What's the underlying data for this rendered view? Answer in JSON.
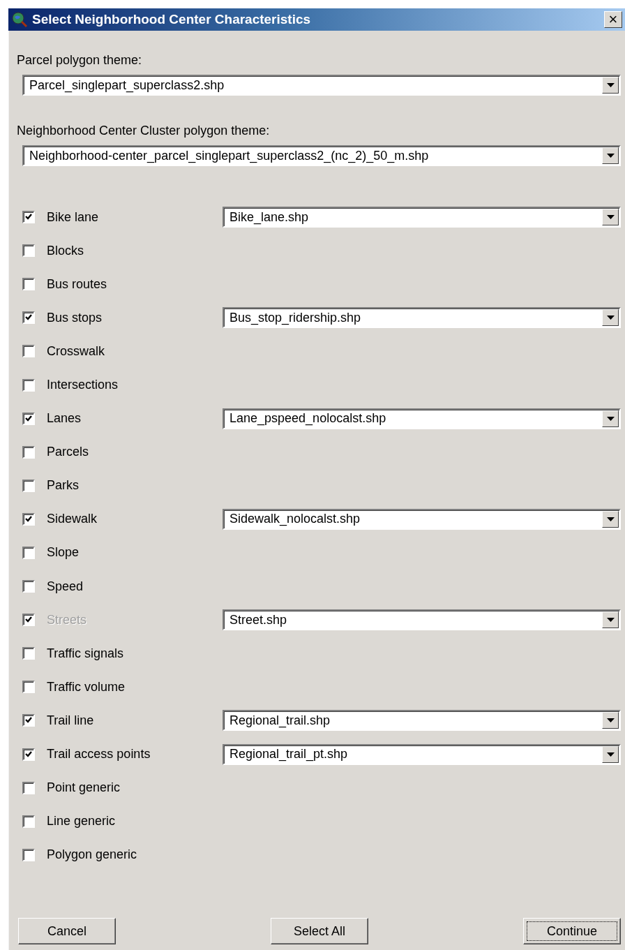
{
  "window": {
    "title": "Select Neighborhood Center Characteristics",
    "close": "×"
  },
  "themes": [
    {
      "label": "Parcel polygon theme:",
      "value": "Parcel_singlepart_superclass2.shp"
    },
    {
      "label": "Neighborhood Center Cluster polygon theme:",
      "value": "Neighborhood-center_parcel_singlepart_superclass2_(nc_2)_50_m.shp"
    }
  ],
  "layers": [
    {
      "label": "Bike lane",
      "checked": true,
      "disabled": false,
      "file": "Bike_lane.shp"
    },
    {
      "label": "Blocks",
      "checked": false,
      "disabled": false
    },
    {
      "label": "Bus routes",
      "checked": false,
      "disabled": false
    },
    {
      "label": "Bus stops",
      "checked": true,
      "disabled": false,
      "file": "Bus_stop_ridership.shp"
    },
    {
      "label": "Crosswalk",
      "checked": false,
      "disabled": false
    },
    {
      "label": "Intersections",
      "checked": false,
      "disabled": false
    },
    {
      "label": "Lanes",
      "checked": true,
      "disabled": false,
      "file": "Lane_pspeed_nolocalst.shp"
    },
    {
      "label": "Parcels",
      "checked": false,
      "disabled": false
    },
    {
      "label": "Parks",
      "checked": false,
      "disabled": false
    },
    {
      "label": "Sidewalk",
      "checked": true,
      "disabled": false,
      "file": "Sidewalk_nolocalst.shp"
    },
    {
      "label": "Slope",
      "checked": false,
      "disabled": false
    },
    {
      "label": "Speed",
      "checked": false,
      "disabled": false
    },
    {
      "label": "Streets",
      "checked": true,
      "disabled": true,
      "file": "Street.shp"
    },
    {
      "label": "Traffic signals",
      "checked": false,
      "disabled": false
    },
    {
      "label": "Traffic volume",
      "checked": false,
      "disabled": false
    },
    {
      "label": "Trail line",
      "checked": true,
      "disabled": false,
      "file": "Regional_trail.shp"
    },
    {
      "label": "Trail access points",
      "checked": true,
      "disabled": false,
      "file": "Regional_trail_pt.shp"
    },
    {
      "label": "Point generic",
      "checked": false,
      "disabled": false
    },
    {
      "label": "Line generic",
      "checked": false,
      "disabled": false
    },
    {
      "label": "Polygon generic",
      "checked": false,
      "disabled": false
    }
  ],
  "buttons": [
    {
      "label": "Cancel",
      "focused": false
    },
    {
      "label": "Select All",
      "focused": false
    },
    {
      "label": "Continue",
      "focused": true
    }
  ]
}
